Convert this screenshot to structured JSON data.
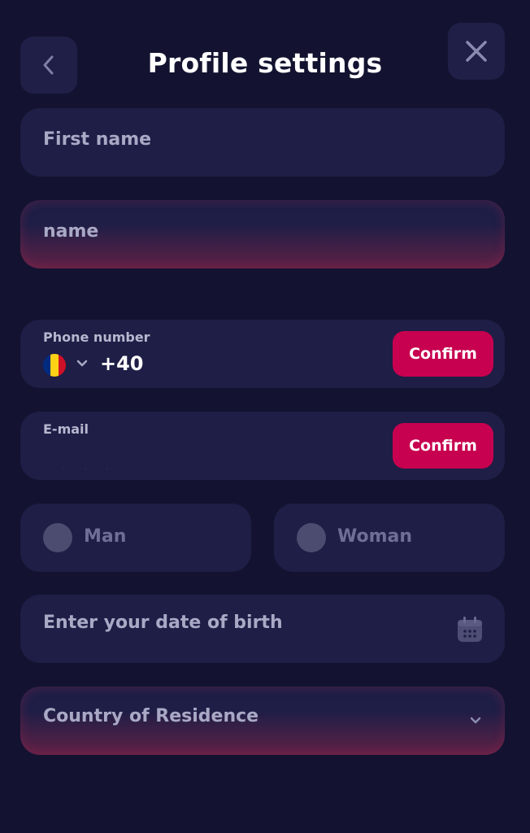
{
  "header": {
    "title": "Profile settings",
    "back_icon": "chevron-left-icon",
    "close_icon": "close-icon"
  },
  "form": {
    "first_name_placeholder": "First name",
    "last_name_placeholder": "name",
    "phone": {
      "label": "Phone number",
      "country_flag": "romania-flag-icon",
      "code": "+40",
      "confirm_label": "Confirm"
    },
    "email": {
      "label": "E-mail",
      "confirm_label": "Confirm"
    },
    "gender": {
      "man_label": "Man",
      "woman_label": "Woman"
    },
    "birth_placeholder": "Enter your date of birth",
    "country_placeholder": "Country of Residence"
  },
  "colors": {
    "background": "#131331",
    "field": "#1e1e46",
    "accent": "#c7004f",
    "error_glow": "#96234a"
  }
}
